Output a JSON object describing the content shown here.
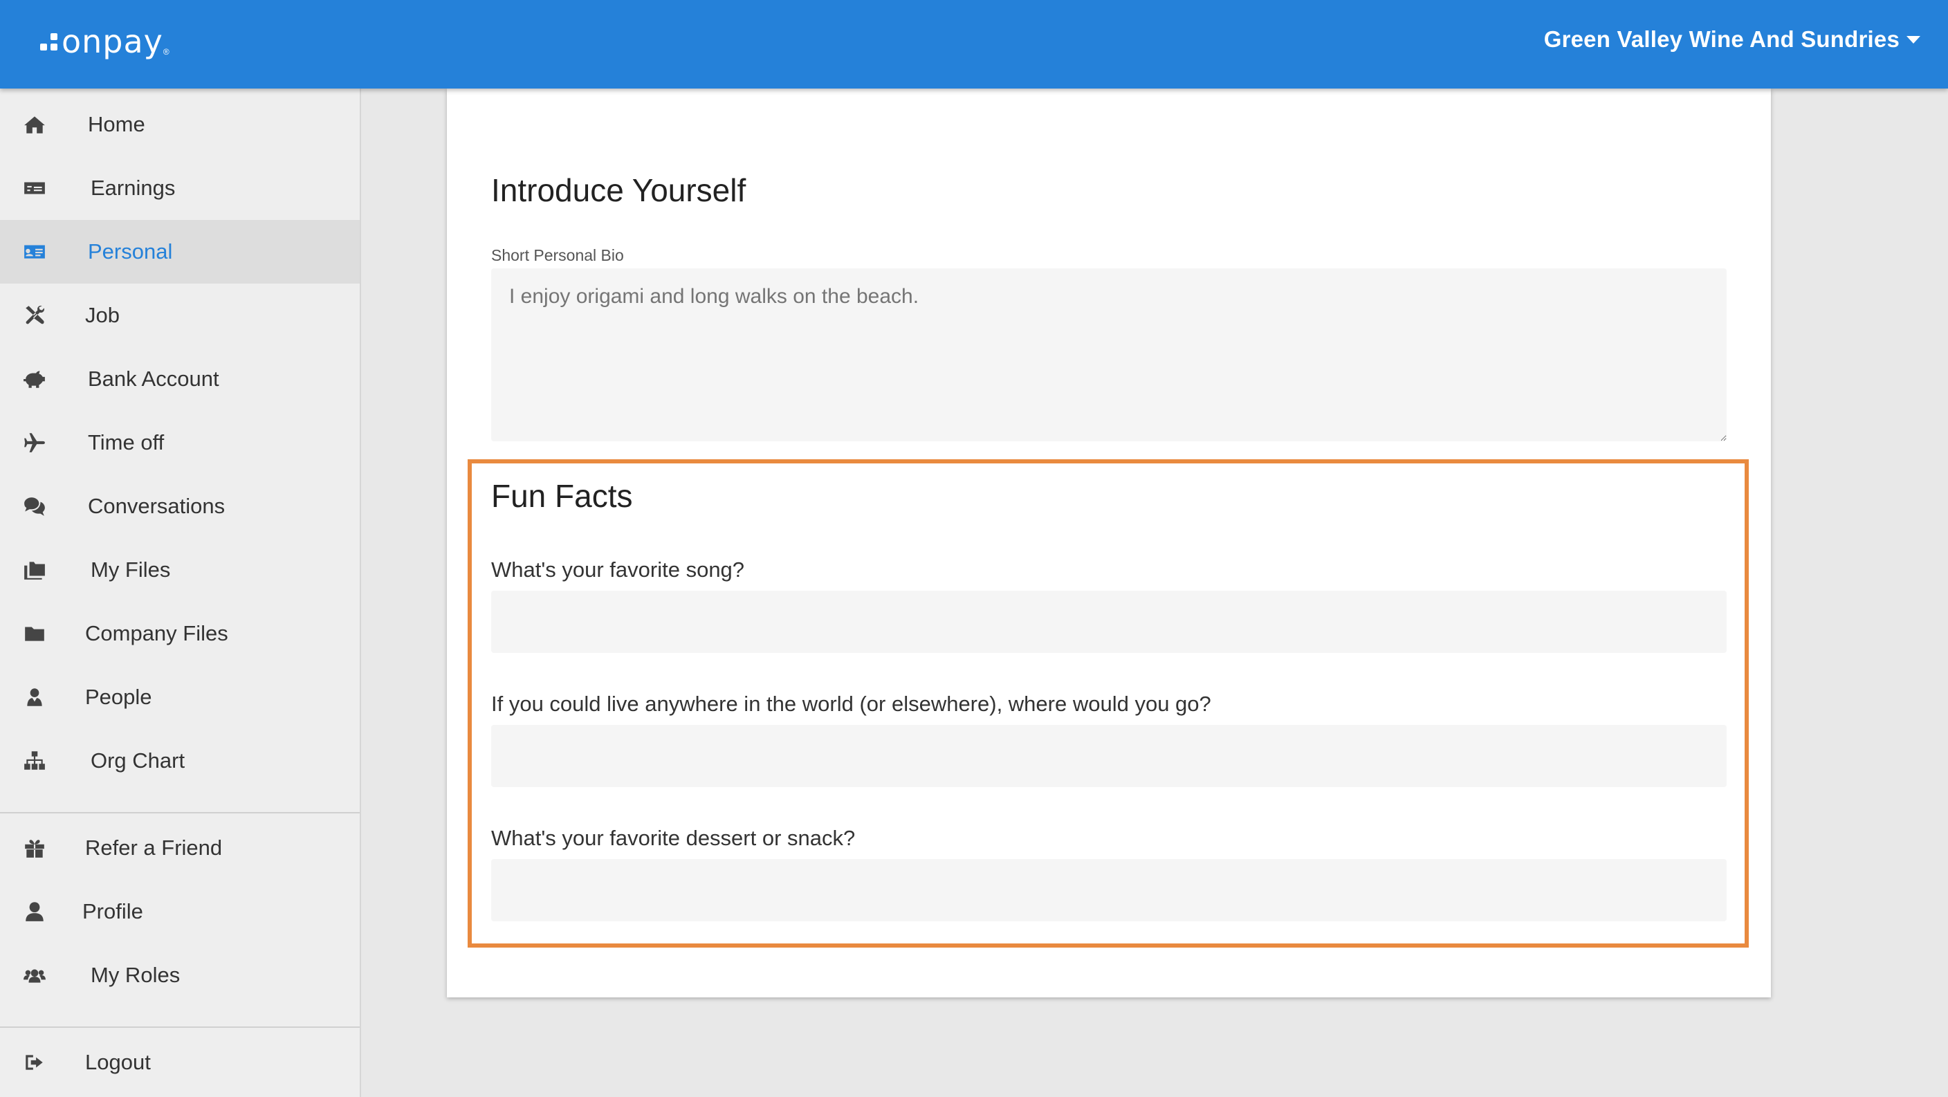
{
  "header": {
    "logo_text": "onpay",
    "logo_mark": "®",
    "company_name": "Green Valley Wine And Sundries"
  },
  "sidebar": {
    "items": [
      {
        "label": "Home",
        "icon": "home-icon"
      },
      {
        "label": "Earnings",
        "icon": "money-icon"
      },
      {
        "label": "Personal",
        "icon": "id-card-icon",
        "active": true
      },
      {
        "label": "Job",
        "icon": "tools-icon"
      },
      {
        "label": "Bank Account",
        "icon": "piggy-bank-icon"
      },
      {
        "label": "Time off",
        "icon": "plane-icon"
      },
      {
        "label": "Conversations",
        "icon": "chat-icon"
      },
      {
        "label": "My Files",
        "icon": "folders-icon"
      },
      {
        "label": "Company Files",
        "icon": "folder-icon"
      },
      {
        "label": "People",
        "icon": "person-icon"
      },
      {
        "label": "Org Chart",
        "icon": "sitemap-icon"
      }
    ],
    "secondary": [
      {
        "label": "Refer a Friend",
        "icon": "gift-icon"
      },
      {
        "label": "Profile",
        "icon": "user-icon"
      },
      {
        "label": "My Roles",
        "icon": "users-icon"
      }
    ],
    "footer": [
      {
        "label": "Logout",
        "icon": "logout-icon"
      }
    ]
  },
  "main": {
    "intro_title": "Introduce Yourself",
    "bio_label": "Short Personal Bio",
    "bio_placeholder": "I enjoy origami and long walks on the beach.",
    "fun_facts_title": "Fun Facts",
    "questions": [
      {
        "label": "What's your favorite song?",
        "value": ""
      },
      {
        "label": "If you could live anywhere in the world (or elsewhere), where would you go?",
        "value": ""
      },
      {
        "label": "What's your favorite dessert or snack?",
        "value": ""
      }
    ]
  },
  "colors": {
    "header_bg": "#2581d9",
    "active_text": "#2581d9",
    "highlight_border": "#e98a3f"
  }
}
